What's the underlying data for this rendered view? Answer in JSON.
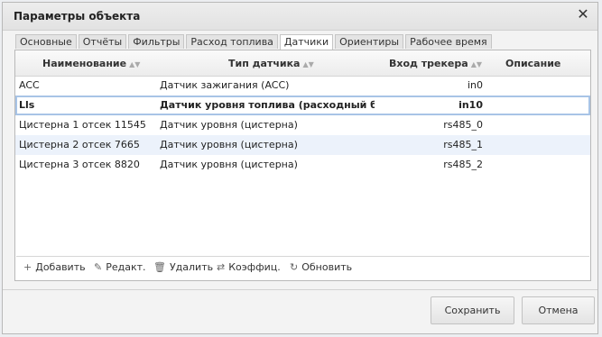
{
  "dialog": {
    "title": "Параметры объекта",
    "close_icon": "close-icon"
  },
  "tabs": [
    {
      "label": "Основные",
      "active": false
    },
    {
      "label": "Отчёты",
      "active": false
    },
    {
      "label": "Фильтры",
      "active": false
    },
    {
      "label": "Расход топлива",
      "active": false
    },
    {
      "label": "Датчики",
      "active": true
    },
    {
      "label": "Ориентиры",
      "active": false
    },
    {
      "label": "Рабочее время",
      "active": false
    }
  ],
  "grid": {
    "columns": {
      "name": "Наименование",
      "type": "Тип датчика",
      "input": "Вход трекера",
      "description": "Описание"
    },
    "rows": [
      {
        "name": "ACC",
        "type": "Датчик зажигания (ACC)",
        "input": "in0",
        "description": ""
      },
      {
        "name": "Lls",
        "type": "Датчик уровня топлива (расходный ба",
        "input": "in10",
        "description": ""
      },
      {
        "name": "Цистерна 1 отсек 11545",
        "type": "Датчик уровня (цистерна)",
        "input": "rs485_0",
        "description": ""
      },
      {
        "name": "Цистерна 2 отсек 7665",
        "type": "Датчик уровня (цистерна)",
        "input": "rs485_1",
        "description": ""
      },
      {
        "name": "Цистерна 3 отсек 8820",
        "type": "Датчик уровня (цистерна)",
        "input": "rs485_2",
        "description": ""
      }
    ],
    "selected_row": 1
  },
  "toolbar": {
    "add": "Добавить",
    "edit": "Редакт.",
    "delete": "Удалить",
    "coefficients": "Коэффиц.",
    "refresh": "Обновить"
  },
  "footer": {
    "save": "Сохранить",
    "cancel": "Отмена"
  },
  "colors": {
    "selected_border": "#a8c4e6",
    "alt_row": "#ecf2fb"
  }
}
